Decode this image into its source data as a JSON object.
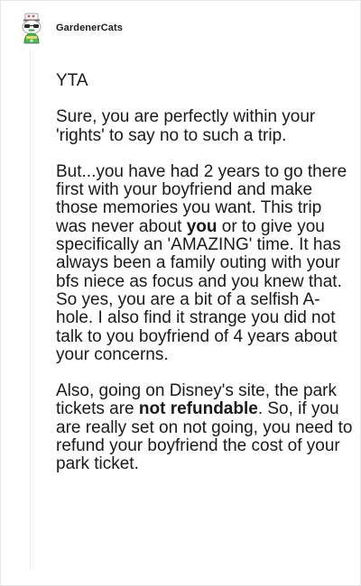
{
  "comment": {
    "author": {
      "username": "GardenerCats",
      "avatar_icon": "snoo-avatar-icon"
    },
    "paragraphs": [
      {
        "segments": [
          {
            "text": "YTA",
            "bold": false
          }
        ]
      },
      {
        "segments": [
          {
            "text": "Sure, you are perfectly within your 'rights' to say no to such a trip.",
            "bold": false
          }
        ]
      },
      {
        "segments": [
          {
            "text": "But...you have had 2 years to go there first with your boyfriend and make those memories you want. This trip was never about ",
            "bold": false
          },
          {
            "text": "you",
            "bold": true
          },
          {
            "text": " or to give you specifically an 'AMAZING' time. It has always been a family outing with your bfs niece as focus and you knew that. So yes, you are a bit of a selfish A-hole. I also find it strange you did not talk to you boyfriend of 4 years about your concerns.",
            "bold": false
          }
        ]
      },
      {
        "segments": [
          {
            "text": "Also, going on Disney's site, the park tickets are ",
            "bold": false
          },
          {
            "text": "not refundable",
            "bold": true
          },
          {
            "text": ". So, if you are really set on not going, you need to refund your boyfriend the cost of your park ticket.",
            "bold": false
          }
        ]
      }
    ]
  }
}
